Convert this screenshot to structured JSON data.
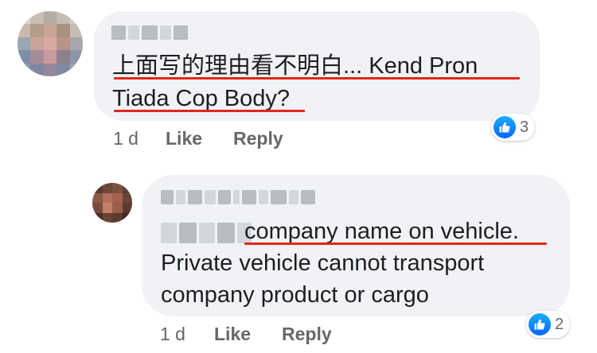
{
  "comments": [
    {
      "line1": "上面写的理由看不明白... Kend Pron",
      "line2": "Tiada Cop Body?",
      "time": "1 d",
      "like_label": "Like",
      "reply_label": "Reply",
      "reaction_count": "3"
    },
    {
      "line1": "company name on vehicle.",
      "line2": "Private vehicle cannot transport",
      "line3": "company product or cargo",
      "time": "1 d",
      "like_label": "Like",
      "reply_label": "Reply",
      "reaction_count": "2"
    }
  ],
  "icons": {
    "reaction": "like-thumb-icon"
  },
  "colors": {
    "bubble": "#f0f2f5",
    "underline": "#e1261c",
    "like_blue": "#0866ff",
    "meta_text": "#65676b"
  }
}
